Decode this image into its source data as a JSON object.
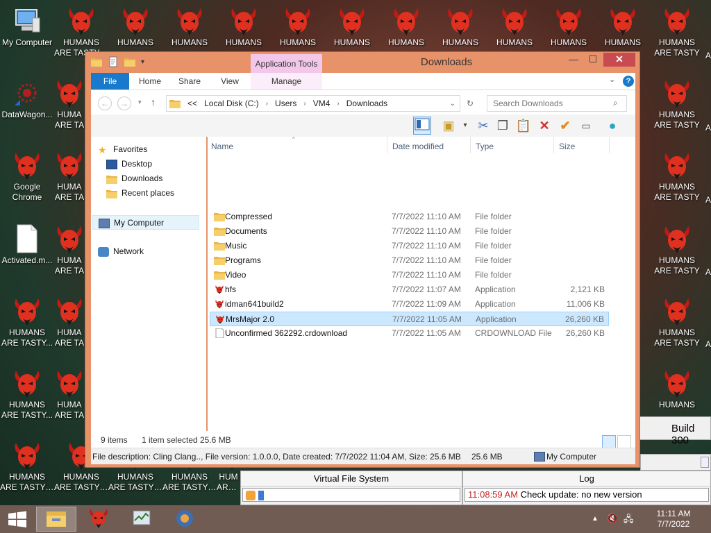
{
  "desktop": {
    "icons": {
      "my_computer": "My Computer",
      "datawagon": "DataWagon...",
      "chrome_line1": "Google",
      "chrome_line2": "Chrome",
      "activated": "Activated.m...",
      "humans_short": "HUMANS",
      "humans_tasty": "ARE TASTY ...",
      "humans_tasty_cut": "ARE TASTY...",
      "humans_cut": "HUMA",
      "humans_cut2": "ARE TA",
      "humans_cut3": "HUM",
      "humans_cut4": "ARE T",
      "humans_right": "HUMANS",
      "humans_right_tasty": "ARE TASTY",
      "humans_right_a": "A"
    }
  },
  "bg_windows": {
    "build_label": "Build 300",
    "vfs_header": "Virtual File System",
    "log_header": "Log",
    "log_time": "11:08:59 AM",
    "log_message": "Check update: no new version"
  },
  "explorer": {
    "title": "Downloads",
    "app_tools": "Application Tools",
    "tabs": {
      "file": "File",
      "home": "Home",
      "share": "Share",
      "view": "View",
      "manage": "Manage"
    },
    "breadcrumb": [
      "<<",
      "Local Disk (C:)",
      "Users",
      "VM4",
      "Downloads"
    ],
    "search_placeholder": "Search Downloads",
    "columns": {
      "name": "Name",
      "date": "Date modified",
      "type": "Type",
      "size": "Size"
    },
    "nav": {
      "favorites": "Favorites",
      "desktop": "Desktop",
      "downloads": "Downloads",
      "recent": "Recent places",
      "my_computer": "My Computer",
      "network": "Network"
    },
    "files": [
      {
        "name": "Compressed",
        "date": "7/7/2022 11:10 AM",
        "type": "File folder",
        "size": "",
        "icon": "folder-icon"
      },
      {
        "name": "Documents",
        "date": "7/7/2022 11:10 AM",
        "type": "File folder",
        "size": "",
        "icon": "folder-icon"
      },
      {
        "name": "Music",
        "date": "7/7/2022 11:10 AM",
        "type": "File folder",
        "size": "",
        "icon": "folder-icon"
      },
      {
        "name": "Programs",
        "date": "7/7/2022 11:10 AM",
        "type": "File folder",
        "size": "",
        "icon": "folder-icon"
      },
      {
        "name": "Video",
        "date": "7/7/2022 11:10 AM",
        "type": "File folder",
        "size": "",
        "icon": "folder-icon"
      },
      {
        "name": "hfs",
        "date": "7/7/2022 11:07 AM",
        "type": "Application",
        "size": "2,121 KB",
        "icon": "demon-app-icon"
      },
      {
        "name": "idman641build2",
        "date": "7/7/2022 11:09 AM",
        "type": "Application",
        "size": "11,006 KB",
        "icon": "demon-app-icon"
      },
      {
        "name": "MrsMajor 2.0",
        "date": "7/7/2022 11:05 AM",
        "type": "Application",
        "size": "26,260 KB",
        "icon": "demon-app-icon"
      },
      {
        "name": "Unconfirmed 362292.crdownload",
        "date": "7/7/2022 11:05 AM",
        "type": "CRDOWNLOAD File",
        "size": "26,260 KB",
        "icon": "document-icon"
      }
    ],
    "status": {
      "items": "9 items",
      "selected": "1 item selected",
      "selected_size": "25.6 MB"
    },
    "info_bar": {
      "description": "File description: Cling Clang.., File version: 1.0.0.0, Date created: 7/7/2022 11:04 AM, Size: 25.6 MB",
      "size": "25.6 MB",
      "location": "My Computer"
    }
  },
  "taskbar": {
    "time": "11:11 AM",
    "date": "7/7/2022"
  },
  "colors": {
    "window_frame": "#e8926a",
    "file_tab": "#1979ca",
    "selection": "#cce8ff",
    "log_time": "#cc2222",
    "demon_red": "#d42a1e"
  }
}
